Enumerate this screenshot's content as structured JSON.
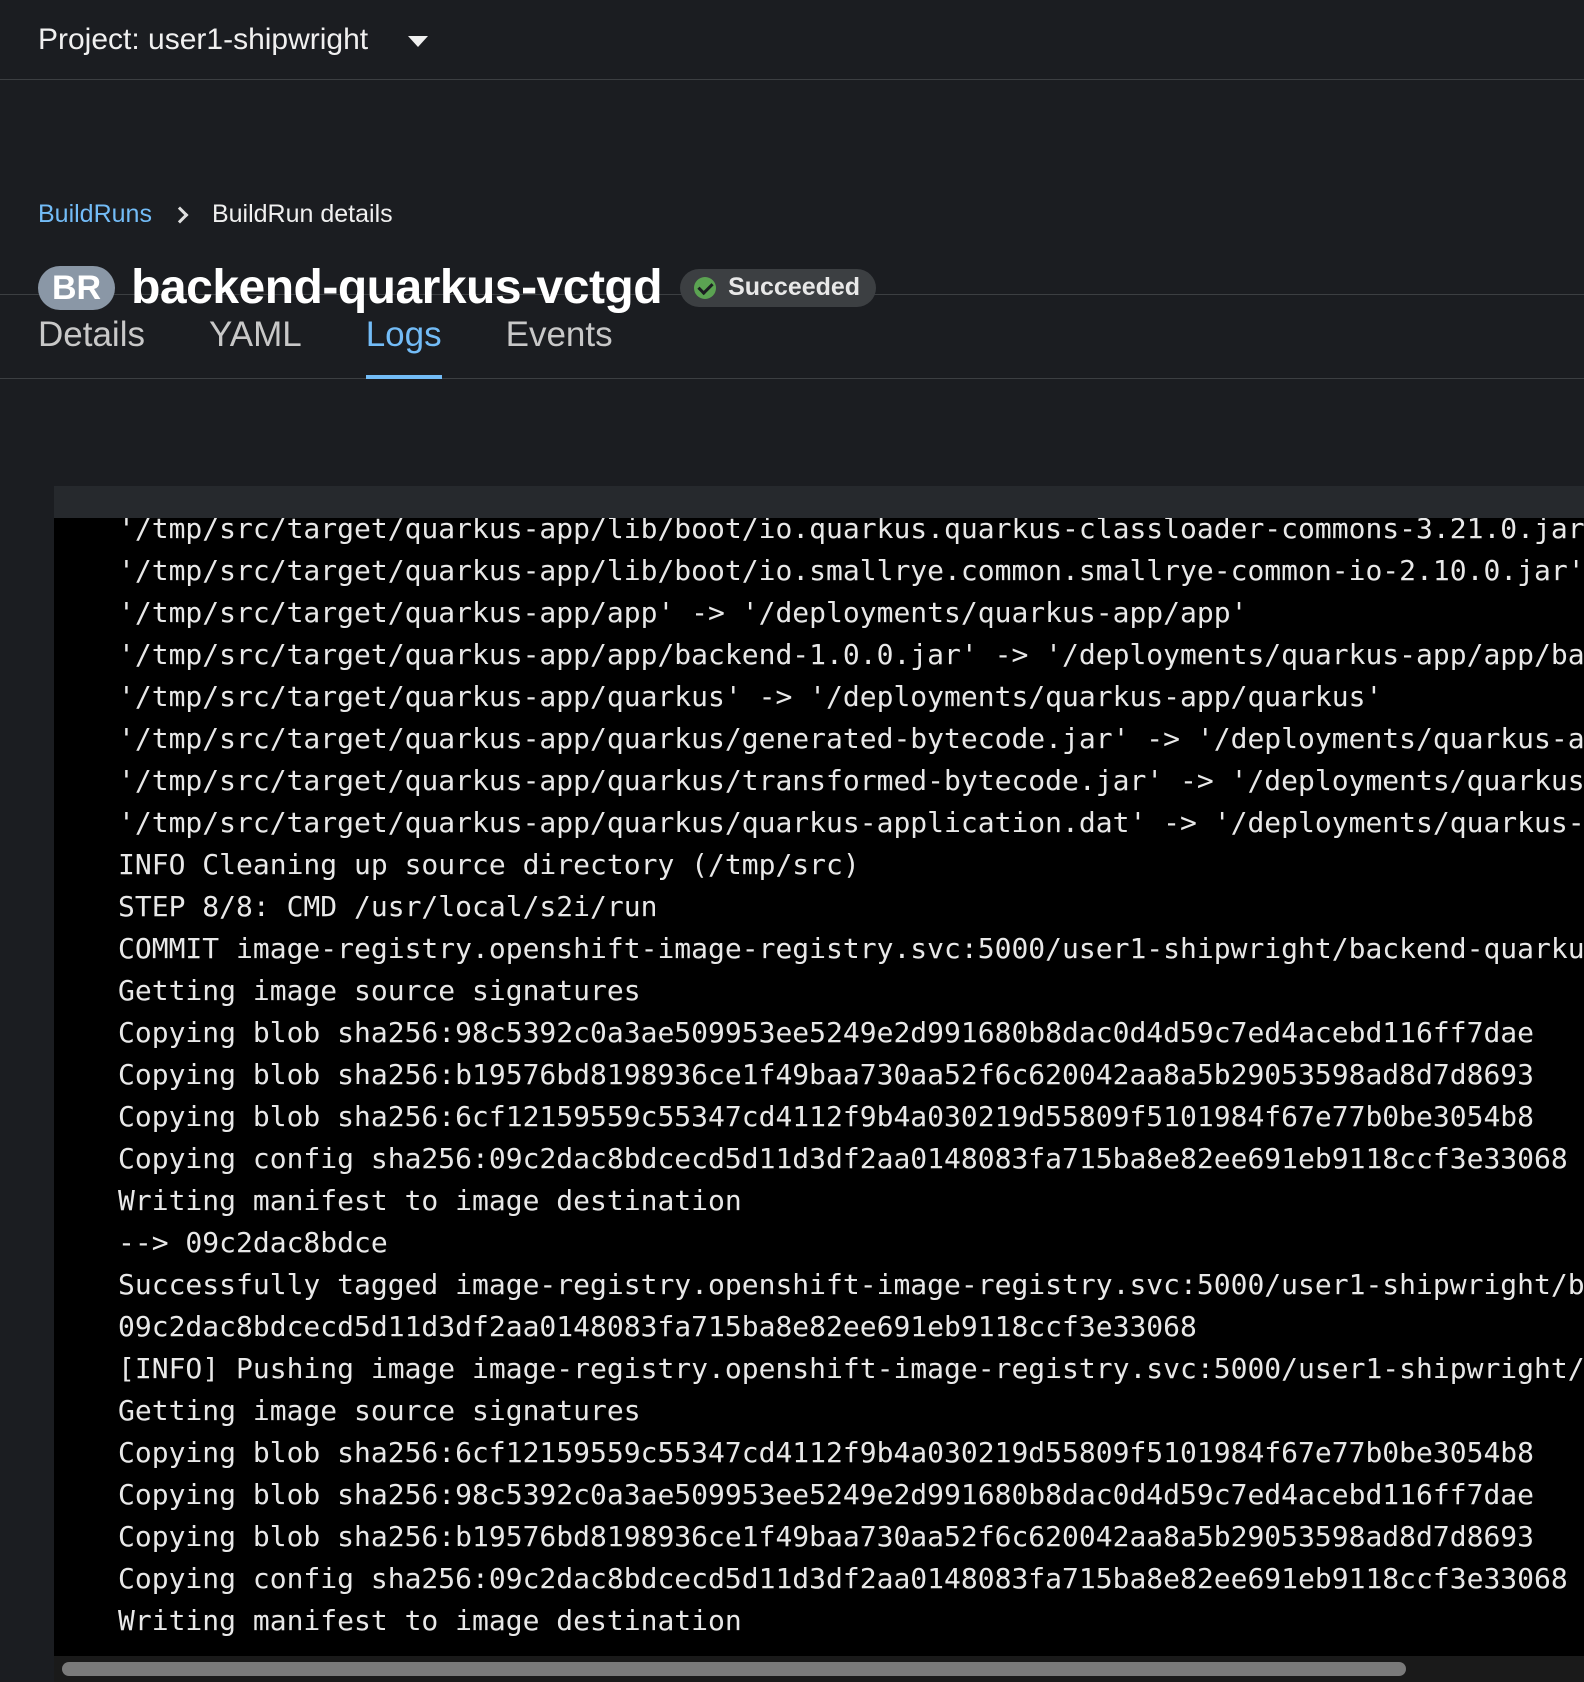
{
  "project": {
    "label": "Project: user1-shipwright"
  },
  "breadcrumb": {
    "parent": "BuildRuns",
    "current": "BuildRun details"
  },
  "header": {
    "badge": "BR",
    "title": "backend-quarkus-vctgd",
    "status": "Succeeded",
    "status_color": "#5ba352"
  },
  "tabs": [
    {
      "label": "Details",
      "active": false
    },
    {
      "label": "YAML",
      "active": false
    },
    {
      "label": "Logs",
      "active": true
    },
    {
      "label": "Events",
      "active": false
    }
  ],
  "logs": {
    "lines": [
      "'/tmp/src/target/quarkus-app/lib/boot/io.quarkus.quarkus-classloader-commons-3.21.0.jar",
      "'/tmp/src/target/quarkus-app/lib/boot/io.smallrye.common.smallrye-common-io-2.10.0.jar'",
      "'/tmp/src/target/quarkus-app/app' -> '/deployments/quarkus-app/app'",
      "'/tmp/src/target/quarkus-app/app/backend-1.0.0.jar' -> '/deployments/quarkus-app/app/ba",
      "'/tmp/src/target/quarkus-app/quarkus' -> '/deployments/quarkus-app/quarkus'",
      "'/tmp/src/target/quarkus-app/quarkus/generated-bytecode.jar' -> '/deployments/quarkus-a",
      "'/tmp/src/target/quarkus-app/quarkus/transformed-bytecode.jar' -> '/deployments/quarkus",
      "'/tmp/src/target/quarkus-app/quarkus/quarkus-application.dat' -> '/deployments/quarkus-",
      "INFO Cleaning up source directory (/tmp/src)",
      "STEP 8/8: CMD /usr/local/s2i/run",
      "COMMIT image-registry.openshift-image-registry.svc:5000/user1-shipwright/backend-quarku",
      "Getting image source signatures",
      "Copying blob sha256:98c5392c0a3ae509953ee5249e2d991680b8dac0d4d59c7ed4acebd116ff7dae",
      "Copying blob sha256:b19576bd8198936ce1f49baa730aa52f6c620042aa8a5b29053598ad8d7d8693",
      "Copying blob sha256:6cf12159559c55347cd4112f9b4a030219d55809f5101984f67e77b0be3054b8",
      "Copying config sha256:09c2dac8bdcecd5d11d3df2aa0148083fa715ba8e82ee691eb9118ccf3e33068",
      "Writing manifest to image destination",
      "--> 09c2dac8bdce",
      "Successfully tagged image-registry.openshift-image-registry.svc:5000/user1-shipwright/b",
      "09c2dac8bdcecd5d11d3df2aa0148083fa715ba8e82ee691eb9118ccf3e33068",
      "[INFO] Pushing image image-registry.openshift-image-registry.svc:5000/user1-shipwright/",
      "Getting image source signatures",
      "Copying blob sha256:6cf12159559c55347cd4112f9b4a030219d55809f5101984f67e77b0be3054b8",
      "Copying blob sha256:98c5392c0a3ae509953ee5249e2d991680b8dac0d4d59c7ed4acebd116ff7dae",
      "Copying blob sha256:b19576bd8198936ce1f49baa730aa52f6c620042aa8a5b29053598ad8d7d8693",
      "Copying config sha256:09c2dac8bdcecd5d11d3df2aa0148083fa715ba8e82ee691eb9118ccf3e33068",
      "Writing manifest to image destination"
    ]
  }
}
